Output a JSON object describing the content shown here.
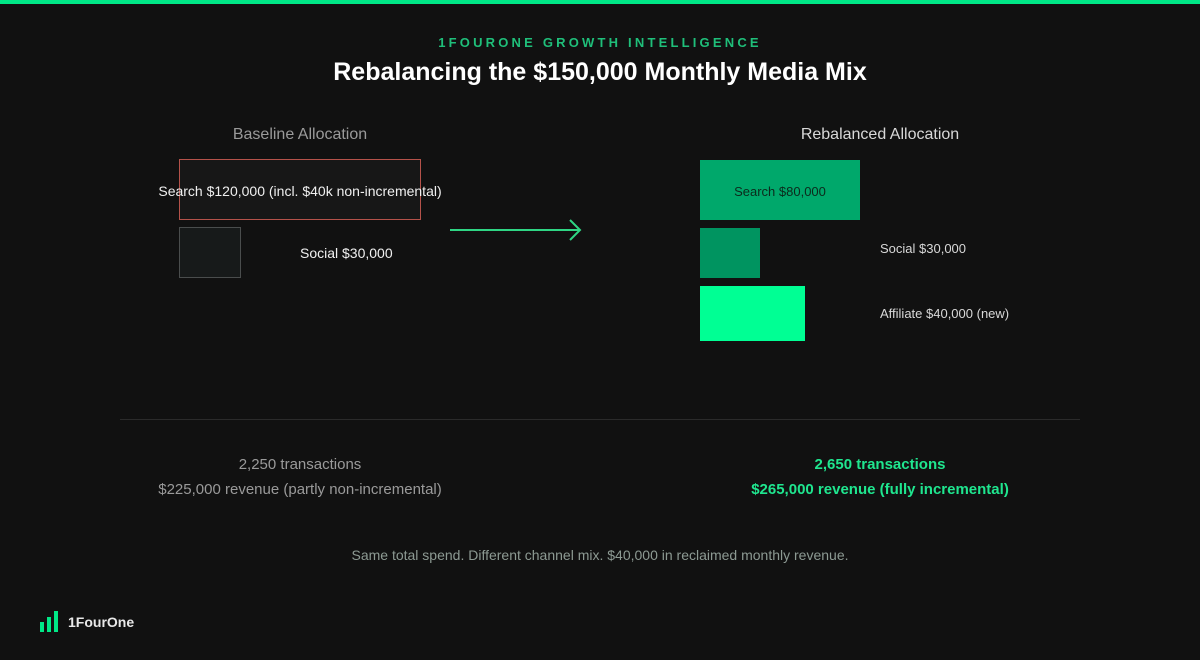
{
  "header": {
    "eyebrow": "1FOURONE GROWTH INTELLIGENCE",
    "title": "Rebalancing the $150,000 Monthly Media Mix"
  },
  "baseline": {
    "title": "Baseline Allocation",
    "search_label": "Search $120,000 (incl. $40k non-incremental)",
    "social_label": "Social $30,000",
    "metric_transactions": "2,250 transactions",
    "metric_revenue": "$225,000 revenue (partly non-incremental)"
  },
  "rebalanced": {
    "title": "Rebalanced Allocation",
    "search_label": "Search $80,000",
    "social_label": "Social $30,000",
    "affiliate_label": "Affiliate $40,000 (new)",
    "metric_transactions": "2,650 transactions",
    "metric_revenue": "$265,000 revenue (fully incremental)"
  },
  "footnote": "Same total spend. Different channel mix. $40,000 in reclaimed monthly revenue.",
  "brand": {
    "name": "1FourOne",
    "accent_color": "#00e887"
  }
}
